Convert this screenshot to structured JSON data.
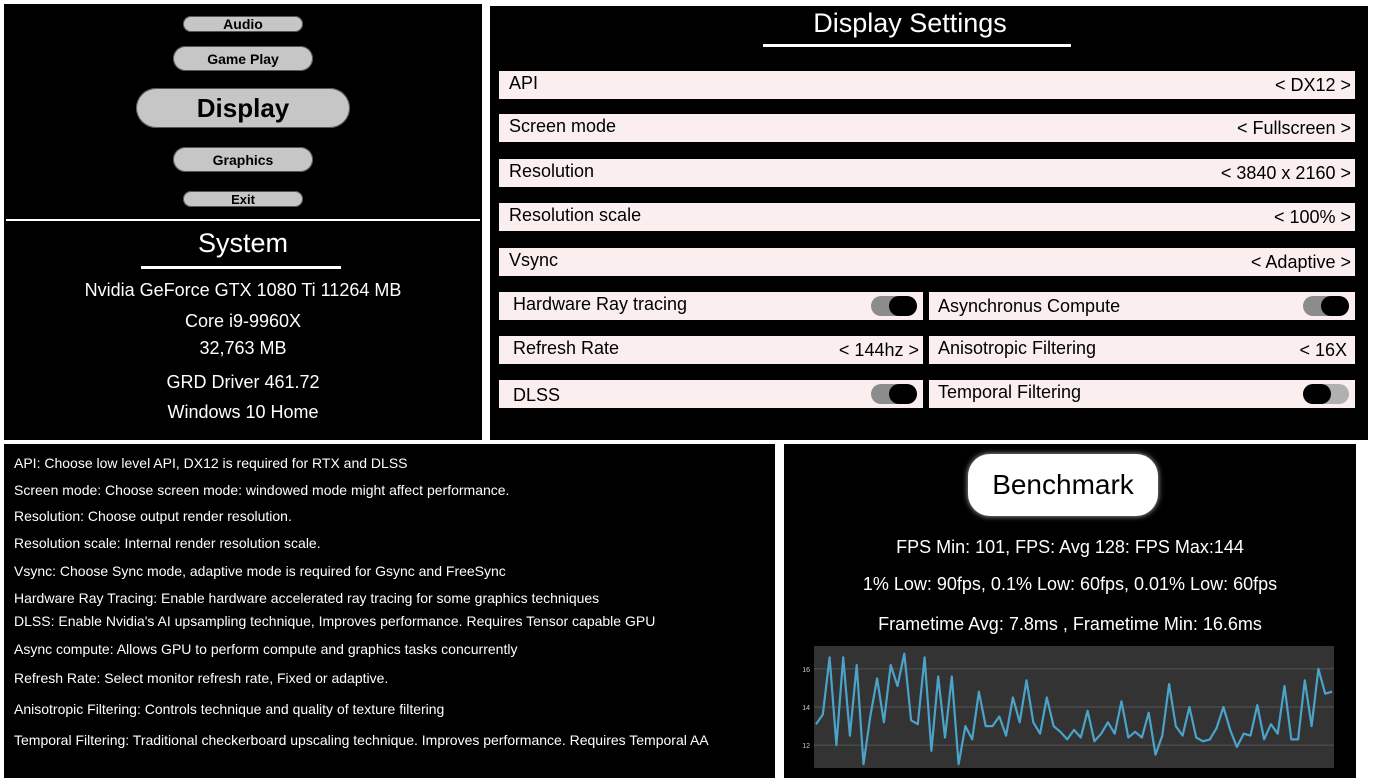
{
  "menu": {
    "audio": "Audio",
    "gameplay": "Game Play",
    "display": "Display",
    "graphics": "Graphics",
    "exit": "Exit"
  },
  "system": {
    "title": "System",
    "gpu": "Nvidia GeForce GTX 1080 Ti 11264 MB",
    "cpu": "Core i9-9960X",
    "ram": "32,763 MB",
    "driver": "GRD Driver 461.72",
    "os": "Windows 10 Home"
  },
  "settings": {
    "title": "Display Settings",
    "api": {
      "label": "API",
      "value": "< DX12 >"
    },
    "screen_mode": {
      "label": "Screen mode",
      "value": "< Fullscreen >"
    },
    "resolution": {
      "label": "Resolution",
      "value": "< 3840 x 2160 >"
    },
    "resolution_scale": {
      "label": "Resolution scale",
      "value": "< 100% >"
    },
    "vsync": {
      "label": "Vsync",
      "value": "< Adaptive >"
    },
    "hw_ray_tracing": {
      "label": "Hardware Ray tracing",
      "enabled": true
    },
    "async_compute": {
      "label": "Asynchronus Compute",
      "enabled": true
    },
    "refresh_rate": {
      "label": "Refresh Rate",
      "value": "< 144hz >"
    },
    "anisotropic": {
      "label": "Anisotropic Filtering",
      "value": "< 16X"
    },
    "dlss": {
      "label": "DLSS",
      "enabled": true
    },
    "temporal": {
      "label": "Temporal Filtering",
      "enabled": false
    }
  },
  "help": [
    "API: Choose low level API, DX12 is required for RTX and DLSS",
    "Screen mode: Choose screen mode: windowed mode might affect performance.",
    "Resolution: Choose output render resolution.",
    "Resolution scale:  Internal render resolution scale.",
    "Vsync: Choose Sync mode, adaptive mode is required for Gsync and FreeSync",
    "Hardware Ray Tracing: Enable hardware accelerated ray tracing for some graphics techniques",
    "DLSS: Enable Nvidia's AI upsampling technique, Improves performance. Requires Tensor capable GPU",
    "Async compute: Allows GPU to perform compute and graphics tasks concurrently",
    "Refresh Rate: Select monitor refresh rate, Fixed or adaptive.",
    "Anisotropic Filtering: Controls technique and quality of texture filtering",
    "Temporal Filtering: Traditional checkerboard upscaling technique. Improves performance. Requires Temporal AA"
  ],
  "benchmark": {
    "button": "Benchmark",
    "fps_line": "FPS Min: 101, FPS: Avg 128: FPS Max:144",
    "low_line": "1% Low: 90fps, 0.1% Low: 60fps,  0.01% Low: 60fps",
    "frametime_line": "Frametime Avg: 7.8ms , Frametime Min: 16.6ms"
  },
  "colors": {
    "panel_bg": "#000000",
    "row_bg": "#fbeeee",
    "menu_btn": "#c6c6c6",
    "chart_bg": "#333333",
    "chart_line": "#4aa3c8"
  },
  "chart_data": {
    "type": "line",
    "title": "",
    "xlabel": "",
    "ylabel": "",
    "ylim": [
      10.8,
      17.2
    ],
    "yticks": [
      "12",
      "14",
      "16"
    ],
    "grid": true,
    "series": [
      {
        "values": [
          13.1,
          13.6,
          16.6,
          12.0,
          16.6,
          12.5,
          16.2,
          11.0,
          13.5,
          15.5,
          13.2,
          16.2,
          15.1,
          16.8,
          13.3,
          13.1,
          16.6,
          11.7,
          15.6,
          12.4,
          15.6,
          11.0,
          13.0,
          12.3,
          14.8,
          13.0,
          13.0,
          13.5,
          12.5,
          14.5,
          13.2,
          15.4,
          13.2,
          12.6,
          14.5,
          13.0,
          12.7,
          12.3,
          12.8,
          12.4,
          13.8,
          12.2,
          12.6,
          13.2,
          12.6,
          14.3,
          12.4,
          12.7,
          12.4,
          13.7,
          11.5,
          12.5,
          15.2,
          13.0,
          12.5,
          14.0,
          12.4,
          12.2,
          12.3,
          12.9,
          14.0,
          12.8,
          11.9,
          12.6,
          12.5,
          14.1,
          12.3,
          13.1,
          12.6,
          15.1,
          12.3,
          12.3,
          15.4,
          13.0,
          16.0,
          14.7,
          14.8
        ]
      }
    ]
  }
}
